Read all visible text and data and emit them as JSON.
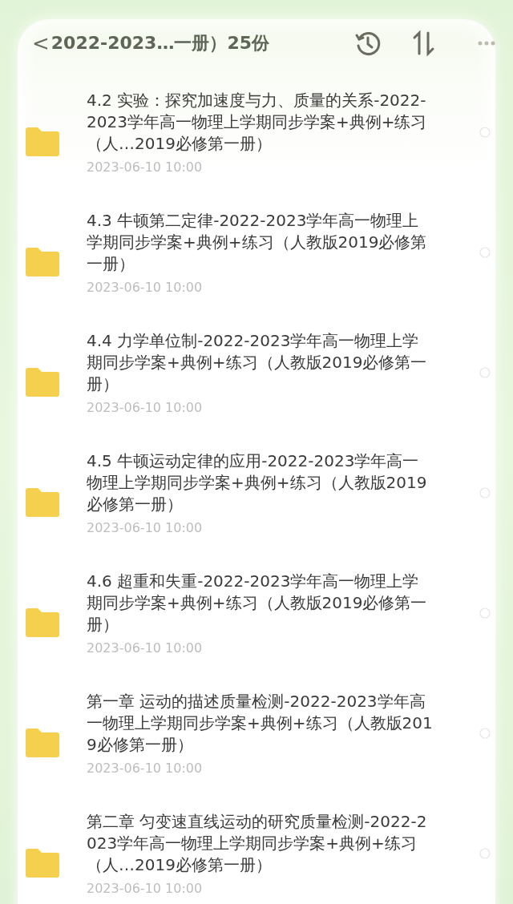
{
  "header": {
    "back": "<",
    "title": "2022-2023…一册）25份"
  },
  "files": [
    {
      "title": "4.2 实验：探究加速度与力、质量的关系-2022-2023学年高一物理上学期同步学案+典例+练习（人…2019必修第一册）",
      "date": "2023-06-10 10:00"
    },
    {
      "title": "4.3 牛顿第二定律-2022-2023学年高一物理上学期同步学案+典例+练习（人教版2019必修第一册）",
      "date": "2023-06-10 10:00"
    },
    {
      "title": "4.4 力学单位制-2022-2023学年高一物理上学期同步学案+典例+练习（人教版2019必修第一册）",
      "date": "2023-06-10 10:00"
    },
    {
      "title": "4.5 牛顿运动定律的应用-2022-2023学年高一物理上学期同步学案+典例+练习（人教版2019必修第一册）",
      "date": "2023-06-10 10:00"
    },
    {
      "title": "4.6 超重和失重-2022-2023学年高一物理上学期同步学案+典例+练习（人教版2019必修第一册）",
      "date": "2023-06-10 10:00"
    },
    {
      "title": "第一章 运动的描述质量检测-2022-2023学年高一物理上学期同步学案+典例+练习（人教版2019必修第一册）",
      "date": "2023-06-10 10:00"
    },
    {
      "title": "第二章 匀变速直线运动的研究质量检测-2022-2023学年高一物理上学期同步学案+典例+练习（人…2019必修第一册）",
      "date": "2023-06-10 10:00"
    }
  ]
}
